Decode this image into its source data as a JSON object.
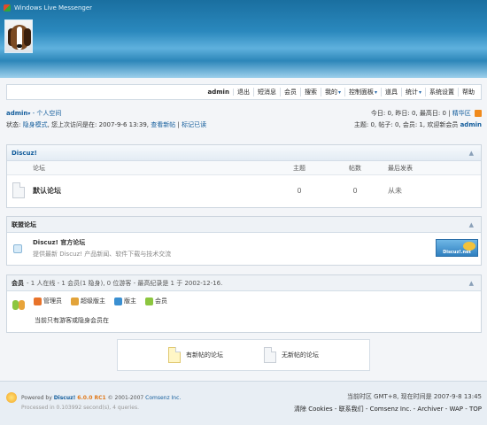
{
  "window": {
    "title": "Windows Live Messenger"
  },
  "nav": {
    "items": [
      "admin",
      "退出",
      "短消息",
      "会员",
      "搜索",
      "我的",
      "控制面板",
      "道具",
      "统计",
      "系统设置",
      "帮助"
    ],
    "dropdown_indices": [
      5,
      6,
      8
    ]
  },
  "userbar": {
    "username": "admin",
    "space_link": "- 个人空间",
    "status_label": "状态:",
    "status_mode": "隐身模式",
    "last_visit": ", 您上次访问是在: 2007-9-6 13:39,",
    "view_new": "查看新帖",
    "mark_read": "标记已读",
    "stats_line1": "今日: 0, 昨日: 0, 最高日: 0 |",
    "digest_link": "精华区",
    "stats_line2": "主题: 0, 帖子: 0, 会员: 1, 欢迎新会员",
    "new_member": "admin"
  },
  "forum_box": {
    "title": "Discuz!",
    "col_forum": "论坛",
    "col_topics": "主题",
    "col_posts": "帖数",
    "col_last": "最后发表",
    "rows": [
      {
        "name": "默认论坛",
        "topics": "0",
        "posts": "0",
        "last": "从未"
      }
    ]
  },
  "link_box": {
    "title": "联盟论坛",
    "name": "Discuz! 官方论坛",
    "desc": "提供最新 Discuz! 产品新闻、软件下载与技术交流",
    "badge": "Discuz!.net"
  },
  "online_box": {
    "title": "会员",
    "summary": "- 1 人在线 - 1 会员(1 隐身), 0 位游客 - 最高纪录是 1 于 2002-12-16.",
    "roles": [
      "管理员",
      "超级版主",
      "版主",
      "会员"
    ],
    "role_colors": [
      "#e8732a",
      "#e2a33a",
      "#3a8fd1",
      "#8cc63f"
    ],
    "note": "当前只有游客或隐身会员在"
  },
  "legend": {
    "has_new": "有新帖的论坛",
    "no_new": "无新帖的论坛"
  },
  "footer": {
    "powered": "Powered by",
    "product": "Discuz!",
    "version": "6.0.0 RC1",
    "copyright": "© 2001-2007",
    "company": "Comsenz Inc.",
    "processed": "Processed in 0.103992 second(s), 4 queries.",
    "timezone": "当前时区 GMT+8, 现在时间是 2007-9-8 13:45",
    "links": "清除 Cookies - 联系我们 - Comsenz Inc. - Archiver - WAP - TOP"
  }
}
